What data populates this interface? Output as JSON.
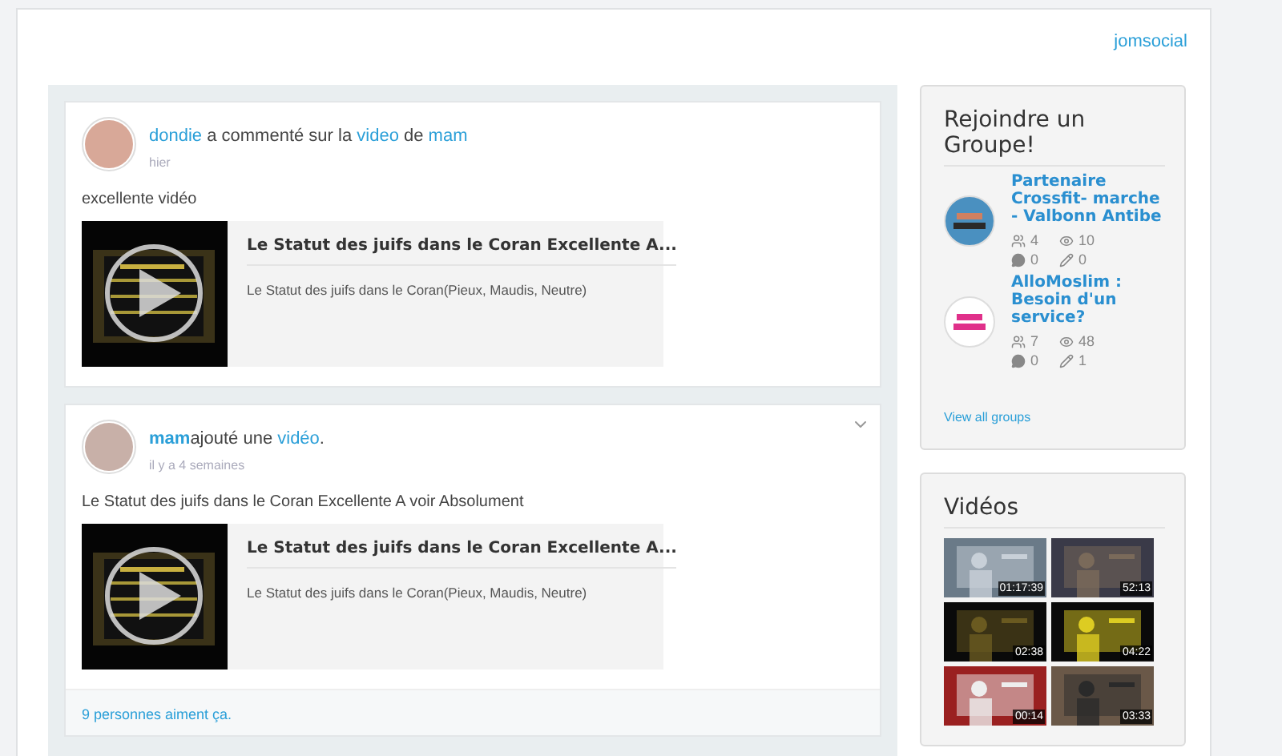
{
  "header": {
    "brand_link": "jomsocial"
  },
  "feed": [
    {
      "actor_parts": [
        {
          "kind": "link",
          "text": "dondie",
          "bold": false
        },
        {
          "kind": "text",
          "text": " a commenté sur la "
        },
        {
          "kind": "link",
          "text": "video",
          "bold": false
        },
        {
          "kind": "text",
          "text": " de "
        },
        {
          "kind": "link",
          "text": "mam",
          "bold": false
        }
      ],
      "time": "hier",
      "message": "excellente vidéo",
      "has_menu": false,
      "video": {
        "title": "Le Statut des juifs dans le Coran Excellente A...",
        "description": "Le Statut des juifs dans le Coran(Pieux, Maudis, Neutre)"
      }
    },
    {
      "actor_parts": [
        {
          "kind": "link",
          "text": "mam",
          "bold": true
        },
        {
          "kind": "text",
          "text": "ajouté une "
        },
        {
          "kind": "link",
          "text": "vidéo",
          "bold": false
        },
        {
          "kind": "text",
          "text": "."
        }
      ],
      "time": "il y a 4 semaines",
      "message": "Le Statut des juifs dans le Coran Excellente A voir Absolument",
      "has_menu": true,
      "video": {
        "title": "Le Statut des juifs dans le Coran Excellente A...",
        "description": "Le Statut des juifs dans le Coran(Pieux, Maudis, Neutre)"
      },
      "likes": "9 personnes aiment ça."
    }
  ],
  "groups_card": {
    "title": "Rejoindre un Groupe!",
    "groups": [
      {
        "name": "Partenaire Crossfit- marche - Valbonn Antibe",
        "members": "4",
        "views": "10",
        "comments": "0",
        "edits": "0"
      },
      {
        "name": "AlloMoslim : Besoin d'un service?",
        "members": "7",
        "views": "48",
        "comments": "0",
        "edits": "1"
      }
    ],
    "view_all": "View all groups"
  },
  "videos_card": {
    "title": "Vidéos",
    "videos": [
      {
        "duration": "01:17:39"
      },
      {
        "duration": "52:13"
      },
      {
        "duration": "02:38"
      },
      {
        "duration": "04:22"
      },
      {
        "duration": "00:14"
      },
      {
        "duration": "03:33"
      }
    ]
  }
}
